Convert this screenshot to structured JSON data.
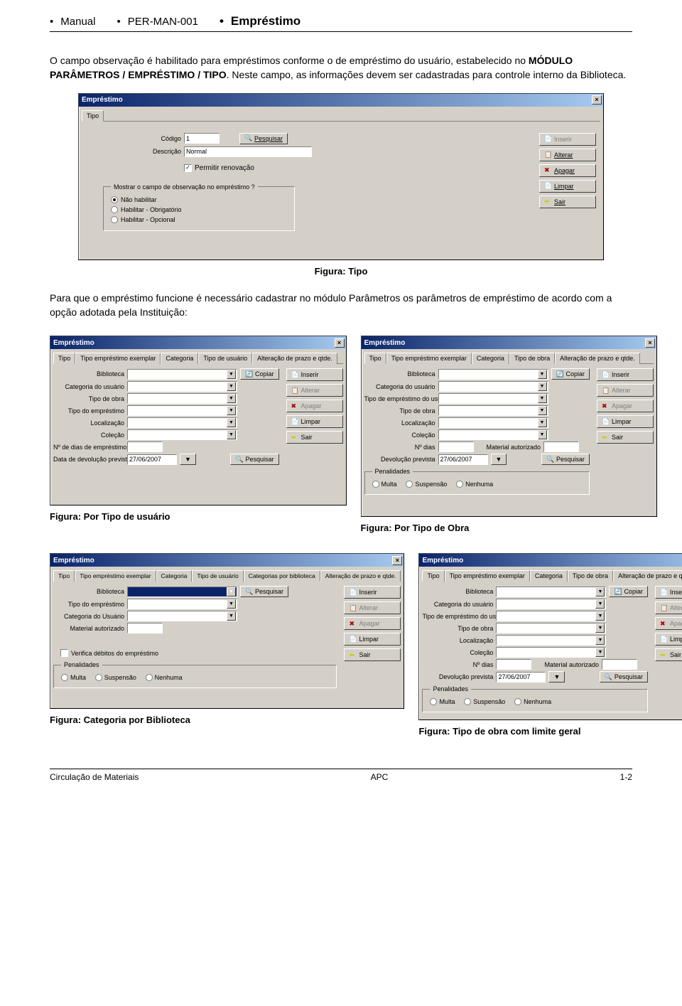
{
  "header": {
    "left": "Manual",
    "center": "PER-MAN-001",
    "right": "Empréstimo"
  },
  "intro1": "O campo observação é habilitado para empréstimos conforme o de empréstimo do usuário, estabelecido no ",
  "intro_bold": "MÓDULO PARÂMETROS / EMPRÉSTIMO / TIPO",
  "intro2": ". Neste campo, as informações devem ser cadastradas para controle interno da Biblioteca.",
  "fig1_caption": "Figura: Tipo",
  "mid_para": "Para que o empréstimo funcione é necessário cadastrar no módulo Parâmetros os parâmetros de empréstimo de acordo com a opção adotada pela Instituição:",
  "fig2a_caption": "Figura: Por Tipo de usuário",
  "fig2b_caption": "Figura: Por Tipo de Obra",
  "fig3a_caption": "Figura: Categoria por Biblioteca",
  "fig3b_caption": "Figura: Tipo de obra com limite geral",
  "footer": {
    "left": "Circulação de Materiais",
    "center": "APC",
    "right": "1-2"
  },
  "win_title": "Empréstimo",
  "tabs": {
    "tipo": "Tipo",
    "tipo_empr_exemplar": "Tipo empréstimo exemplar",
    "categoria": "Categoria",
    "tipo_usuario": "Tipo de usuário",
    "tipo_obra": "Tipo de obra",
    "alteracao": "Alteração de prazo e qtde.",
    "categorias_bib": "Categorias por biblioteca"
  },
  "labels": {
    "codigo": "Código",
    "descricao": "Descrição",
    "permitir_renov": "Permitir renovação",
    "mostrar_obs_legend": "Mostrar o campo de observação no empréstimo ?",
    "nao_habilitar": "Não habilitar",
    "hab_obrig": "Habilitar - Obrigatório",
    "hab_opc": "Habilitar - Opcional",
    "biblioteca": "Biblioteca",
    "categoria_usuario": "Categoria do usuário",
    "categoria_Usuario2": "Categoria do Usuário",
    "tipo_obra": "Tipo de obra",
    "tipo_emprestimo": "Tipo do empréstimo",
    "tipo_emprestimo_usuario": "Tipo de empréstimo do usuário",
    "localizacao": "Localização",
    "colecao": "Coleção",
    "n_dias_empr": "Nº de dias de empréstimo",
    "n_dias": "Nº dias",
    "data_devol": "Data de devolução prevista",
    "devol_prevista": "Devolução prevista",
    "material_autorizado": "Material autorizado",
    "penalidades": "Penalidades",
    "multa": "Multa",
    "suspensao": "Suspensão",
    "nenhuma": "Nenhuma",
    "verifica_debitos": "Verifica débitos do empréstimo"
  },
  "buttons": {
    "pesquisar": "Pesquisar",
    "inserir": "Inserir",
    "alterar": "Alterar",
    "apagar": "Apagar",
    "limpar": "Limpar",
    "sair": "Sair",
    "copiar": "Copiar"
  },
  "values": {
    "codigo": "1",
    "descricao": "Normal",
    "date": "27/06/2007"
  }
}
